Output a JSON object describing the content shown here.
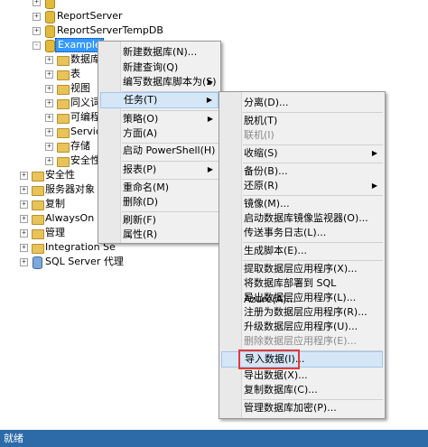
{
  "tree": {
    "nodes": [
      {
        "label": "ReportServer",
        "expander": "+",
        "icon": "database-icon"
      },
      {
        "label": "ReportServerTempDB",
        "expander": "+",
        "icon": "database-icon"
      },
      {
        "label": "Example",
        "expander": "-",
        "icon": "database-icon"
      },
      {
        "label": "数据库关",
        "expander": "+",
        "icon": "folder-icon"
      },
      {
        "label": "表",
        "expander": "+",
        "icon": "folder-icon"
      },
      {
        "label": "视图",
        "expander": "+",
        "icon": "folder-icon"
      },
      {
        "label": "同义词",
        "expander": "+",
        "icon": "folder-icon"
      },
      {
        "label": "可编程性",
        "expander": "+",
        "icon": "folder-icon"
      },
      {
        "label": "Service",
        "expander": "+",
        "icon": "folder-icon"
      },
      {
        "label": "存储",
        "expander": "+",
        "icon": "folder-icon"
      },
      {
        "label": "安全性",
        "expander": "+",
        "icon": "folder-icon"
      },
      {
        "label": "安全性",
        "expander": "+",
        "icon": "folder-icon"
      },
      {
        "label": "服务器对象",
        "expander": "+",
        "icon": "folder-icon"
      },
      {
        "label": "复制",
        "expander": "+",
        "icon": "folder-icon"
      },
      {
        "label": "AlwaysOn 高可",
        "expander": "+",
        "icon": "folder-icon"
      },
      {
        "label": "管理",
        "expander": "+",
        "icon": "folder-icon"
      },
      {
        "label": "Integration Se",
        "expander": "+",
        "icon": "folder-icon"
      },
      {
        "label": "SQL Server 代理",
        "expander": "+",
        "icon": "agent-icon"
      }
    ]
  },
  "context_menu": {
    "items": [
      {
        "label": "新建数据库(N)..."
      },
      {
        "label": "新建查询(Q)"
      },
      {
        "label": "编写数据库脚本为(S)",
        "submenu": true
      },
      {
        "label": "任务(T)",
        "submenu": true
      },
      {
        "label": "策略(O)",
        "submenu": true
      },
      {
        "label": "方面(A)"
      },
      {
        "label": "启动 PowerShell(H)"
      },
      {
        "label": "报表(P)",
        "submenu": true
      },
      {
        "label": "重命名(M)"
      },
      {
        "label": "删除(D)"
      },
      {
        "label": "刷新(F)"
      },
      {
        "label": "属性(R)"
      }
    ]
  },
  "tasks_menu": {
    "items": [
      {
        "label": "分离(D)..."
      },
      {
        "label": "脱机(T)"
      },
      {
        "label": "联机(I)"
      },
      {
        "label": "收缩(S)",
        "submenu": true
      },
      {
        "label": "备份(B)..."
      },
      {
        "label": "还原(R)",
        "submenu": true
      },
      {
        "label": "镜像(M)..."
      },
      {
        "label": "启动数据库镜像监视器(O)..."
      },
      {
        "label": "传送事务日志(L)..."
      },
      {
        "label": "生成脚本(E)..."
      },
      {
        "label": "提取数据层应用程序(X)..."
      },
      {
        "label": "将数据库部署到 SQL Azure(A)..."
      },
      {
        "label": "导出数据层应用程序(L)..."
      },
      {
        "label": "注册为数据层应用程序(R)..."
      },
      {
        "label": "升级数据层应用程序(U)..."
      },
      {
        "label": "删除数据层应用程序(E)..."
      },
      {
        "label": "导入数据(I)..."
      },
      {
        "label": "导出数据(X)..."
      },
      {
        "label": "复制数据库(C)..."
      },
      {
        "label": "管理数据库加密(P)..."
      }
    ]
  },
  "statusbar": {
    "text": "就绪"
  },
  "colors": {
    "status_bar": "#2d6ba8",
    "highlight": "#d5e6f7",
    "red_box": "#e53935",
    "selected": "#3399ff"
  }
}
